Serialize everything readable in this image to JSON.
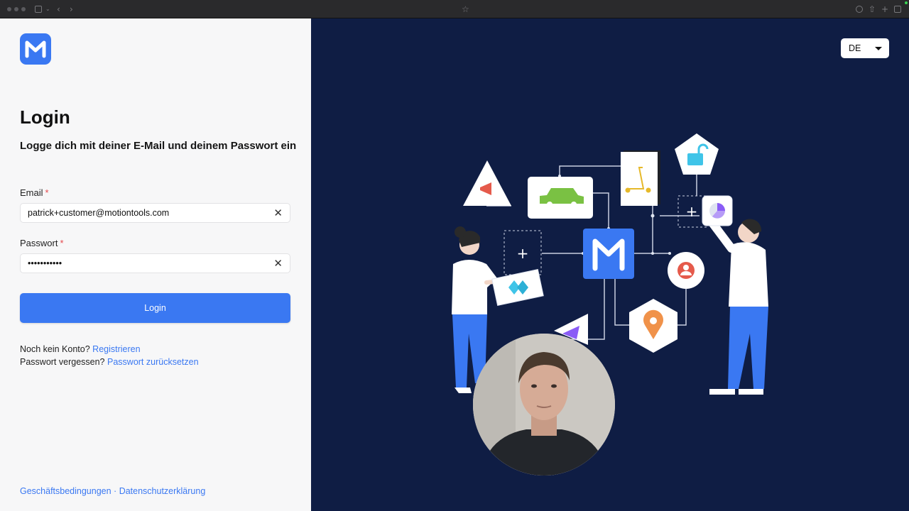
{
  "page": {
    "title": "Login",
    "subtitle": "Logge dich mit deiner E-Mail und deinem Passwort ein"
  },
  "form": {
    "email": {
      "label": "Email",
      "required_mark": "*",
      "value": "patrick+customer@motiontools.com"
    },
    "password": {
      "label": "Passwort",
      "required_mark": "*",
      "value": "•••••••••••"
    },
    "submit_label": "Login"
  },
  "links": {
    "register_prompt": "Noch kein Konto?",
    "register_label": "Registrieren",
    "reset_prompt": "Passwort vergessen?",
    "reset_label": "Passwort zurücksetzen"
  },
  "footer": {
    "terms": "Geschäftsbedingungen",
    "separator": " · ",
    "privacy": "Datenschutzerklärung"
  },
  "language": {
    "selected": "DE"
  },
  "colors": {
    "accent": "#3a78f2",
    "right_panel_bg": "#0f1d44",
    "left_panel_bg": "#f7f7f8",
    "required": "#e5484d"
  },
  "icons": [
    "logo-m-icon",
    "clear-icon",
    "chevron-down-icon",
    "megaphone-icon",
    "car-icon",
    "scooter-icon",
    "unlock-icon",
    "plus-icon",
    "user-icon",
    "location-pin-icon",
    "pie-chart-icon",
    "chevrons-icon",
    "send-icon"
  ]
}
